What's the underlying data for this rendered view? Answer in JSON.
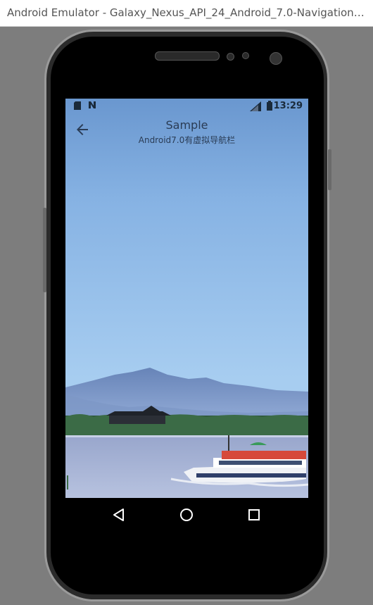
{
  "window": {
    "title": "Android Emulator - Galaxy_Nexus_API_24_Android_7.0-NavigationBar:..."
  },
  "status_bar": {
    "time": "13:29",
    "icons": [
      "sd-card-icon",
      "n-notification-icon",
      "signal-icon",
      "battery-icon"
    ]
  },
  "app_bar": {
    "title": "Sample",
    "subtitle": "Android7.0有虚拟导航栏",
    "back_icon": "arrow-back-icon"
  },
  "content": {
    "image_description_icon": "landscape-photo"
  },
  "nav_bar": {
    "buttons": [
      "back-triangle-icon",
      "home-circle-icon",
      "recents-square-icon"
    ]
  },
  "colors": {
    "sky_top": "#6a97cf",
    "sky_bottom": "#a7cdf0",
    "mountain": "#5f7fb4",
    "water": "#a9b6d8",
    "foreground_text": "#2a3c55"
  }
}
